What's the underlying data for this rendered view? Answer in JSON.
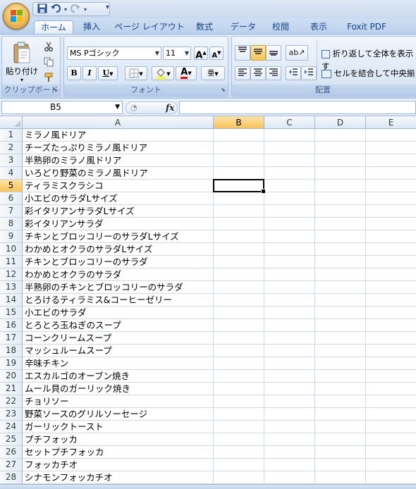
{
  "qat": {
    "save_icon": "save-icon",
    "undo_icon": "undo-icon",
    "redo_icon": "redo-icon",
    "dropdown": "▾"
  },
  "tabs": [
    {
      "label": "ホーム",
      "active": true
    },
    {
      "label": "挿入"
    },
    {
      "label": "ページ レイアウト"
    },
    {
      "label": "数式"
    },
    {
      "label": "データ"
    },
    {
      "label": "校閲"
    },
    {
      "label": "表示"
    },
    {
      "label": "Foxit PDF"
    }
  ],
  "ribbon": {
    "clipboard": {
      "paste_label": "貼り付け",
      "group_label": "クリップボード"
    },
    "font": {
      "font_name": "MS Pゴシック",
      "font_size": "11",
      "grow": "A",
      "shrink": "A",
      "bold": "B",
      "italic": "I",
      "underline": "U",
      "font_color_glyph": "A",
      "phonetic_glyph": "亜",
      "group_label": "フォント"
    },
    "alignment": {
      "wrap_label": "折り返して全体を表示す",
      "merge_label": "セルを結合して中央揃",
      "group_label": "配置"
    }
  },
  "formula_bar": {
    "name_box": "B5",
    "fx": "fx",
    "content": ""
  },
  "sheet": {
    "columns": [
      "A",
      "B",
      "C",
      "D",
      "E"
    ],
    "selected_column": "B",
    "selected_row": 5,
    "rows": [
      {
        "n": "1",
        "a": "ミラノ風ドリア"
      },
      {
        "n": "2",
        "a": "チーズたっぷりミラノ風ドリア"
      },
      {
        "n": "3",
        "a": "半熟卵のミラノ風ドリア"
      },
      {
        "n": "4",
        "a": "いろどり野菜のミラノ風ドリア"
      },
      {
        "n": "5",
        "a": "ティラミスクラシコ"
      },
      {
        "n": "6",
        "a": "小エビのサラダLサイズ"
      },
      {
        "n": "7",
        "a": "彩イタリアンサラダLサイズ"
      },
      {
        "n": "8",
        "a": "彩イタリアンサラダ"
      },
      {
        "n": "9",
        "a": "チキンとブロッコリーのサラダLサイズ"
      },
      {
        "n": "10",
        "a": "わかめとオクラのサラダLサイズ"
      },
      {
        "n": "11",
        "a": "チキンとブロッコリーのサラダ"
      },
      {
        "n": "12",
        "a": "わかめとオクラのサラダ"
      },
      {
        "n": "13",
        "a": "半熟卵のチキンとブロッコリーのサラダ"
      },
      {
        "n": "14",
        "a": "とろけるティラミス&コーヒーゼリー"
      },
      {
        "n": "15",
        "a": "小エビのサラダ"
      },
      {
        "n": "16",
        "a": "とろとろ玉ねぎのスープ"
      },
      {
        "n": "17",
        "a": "コーンクリームスープ"
      },
      {
        "n": "18",
        "a": "マッシュルームスープ"
      },
      {
        "n": "19",
        "a": "辛味チキン"
      },
      {
        "n": "20",
        "a": "エスカルゴのオーブン焼き"
      },
      {
        "n": "21",
        "a": "ムール貝のガーリック焼き"
      },
      {
        "n": "22",
        "a": "チョリソー"
      },
      {
        "n": "23",
        "a": "野菜ソースのグリルソーセージ"
      },
      {
        "n": "24",
        "a": "ガーリックトースト"
      },
      {
        "n": "25",
        "a": "プチフォッカ"
      },
      {
        "n": "26",
        "a": "セットプチフォッカ"
      },
      {
        "n": "27",
        "a": "フォッカチオ"
      },
      {
        "n": "28",
        "a": "シナモンフォッカチオ"
      }
    ]
  }
}
